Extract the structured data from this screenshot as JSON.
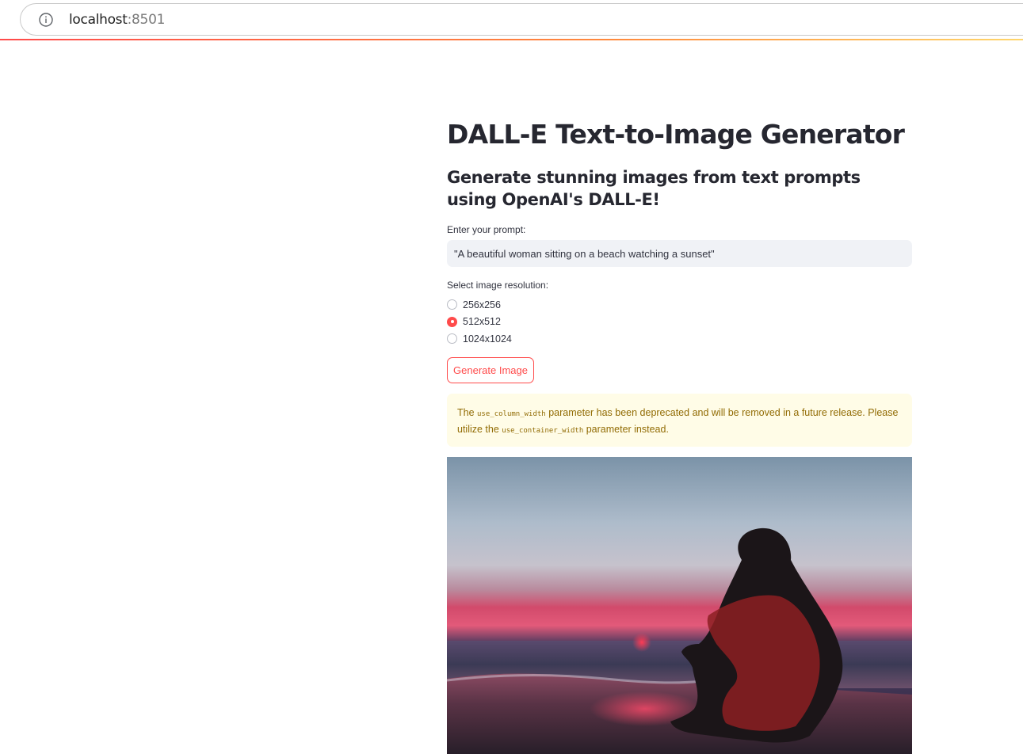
{
  "browser": {
    "url_host": "localhost",
    "url_port": ":8501",
    "info_icon": "info-icon"
  },
  "app": {
    "title": "DALL-E Text-to-Image Generator",
    "subtitle": "Generate stunning images from text prompts using OpenAI's DALL-E!",
    "prompt": {
      "label": "Enter your prompt:",
      "value": "\"A beautiful woman sitting on a beach watching a sunset\""
    },
    "resolution": {
      "label": "Select image resolution:",
      "options": [
        "256x256",
        "512x512",
        "1024x1024"
      ],
      "selected": "512x512"
    },
    "generate_button": "Generate Image",
    "warning": {
      "part1": "The ",
      "code1": "use_column_width",
      "part2": " parameter has been deprecated and will be removed in a future release. Please utilize the ",
      "code2": "use_container_width",
      "part3": " parameter instead."
    },
    "accent_color": "#ff4b4b",
    "warning_text_color": "#926c05",
    "warning_bg_color": "#fffce7"
  }
}
